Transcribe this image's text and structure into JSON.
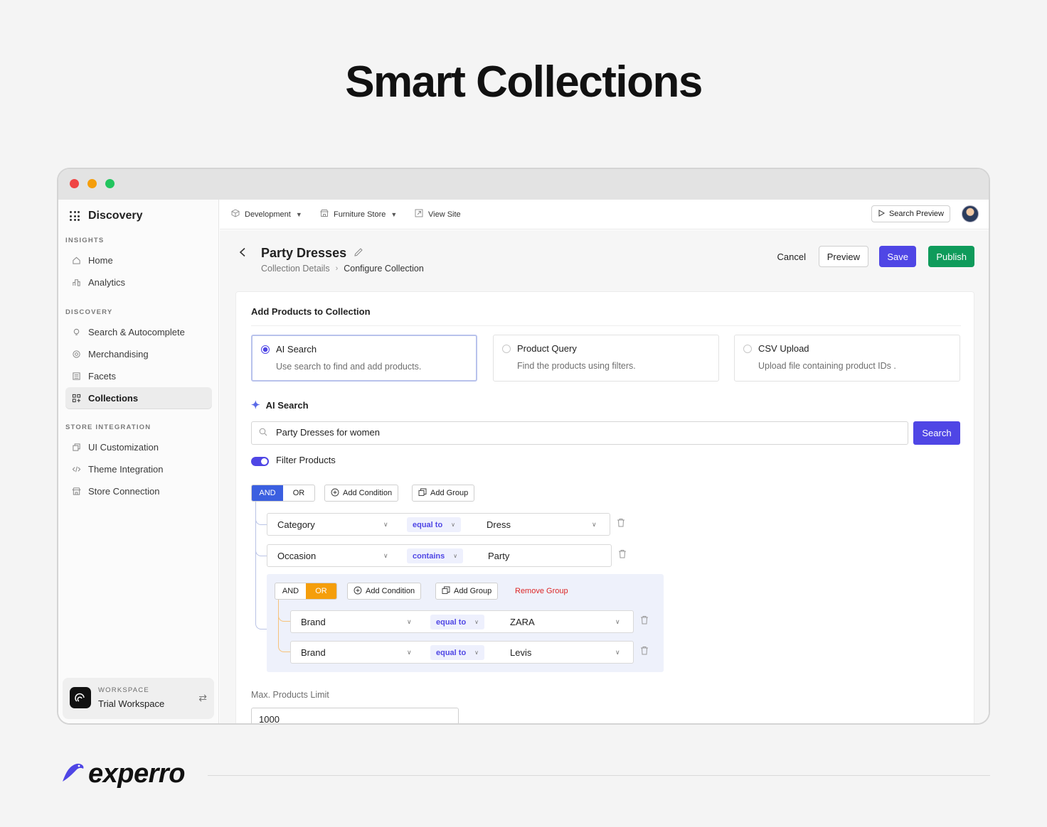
{
  "hero": {
    "title": "Smart Collections"
  },
  "sidebar": {
    "brand": "Discovery",
    "sections": {
      "insights": "INSIGHTS",
      "discovery": "DISCOVERY",
      "store": "STORE INTEGRATION"
    },
    "items": {
      "home": "Home",
      "analytics": "Analytics",
      "search": "Search & Autocomplete",
      "merch": "Merchandising",
      "facets": "Facets",
      "collections": "Collections",
      "ui": "UI Customization",
      "theme": "Theme Integration",
      "store": "Store Connection"
    },
    "workspace": {
      "label": "WORKSPACE",
      "name": "Trial Workspace"
    }
  },
  "topbar": {
    "env": "Development",
    "store": "Furniture Store",
    "view_site": "View Site",
    "search_preview": "Search Preview"
  },
  "header": {
    "title": "Party Dresses",
    "crumb_parent": "Collection Details",
    "crumb_current": "Configure Collection",
    "cancel": "Cancel",
    "preview": "Preview",
    "save": "Save",
    "publish": "Publish"
  },
  "card": {
    "title": "Add Products to Collection",
    "options": [
      {
        "title": "AI Search",
        "desc": "Use search to find and add products."
      },
      {
        "title": "Product Query",
        "desc": "Find the products using filters."
      },
      {
        "title": "CSV Upload",
        "desc": "Upload file containing product IDs ."
      }
    ],
    "ai_label": "AI Search",
    "search_value": "Party Dresses for women",
    "search_button": "Search",
    "filter_label": "Filter Products",
    "limit_label": "Max. Products Limit",
    "limit_value": "1000"
  },
  "filters": {
    "and": "AND",
    "or": "OR",
    "add_condition": "Add Condition",
    "add_group": "Add Group",
    "remove_group": "Remove Group",
    "conditions": [
      {
        "field": "Category",
        "op": "equal to",
        "value": "Dress"
      },
      {
        "field": "Occasion",
        "op": "contains",
        "value": "Party"
      }
    ],
    "group_conditions": [
      {
        "field": "Brand",
        "op": "equal to",
        "value": "ZARA"
      },
      {
        "field": "Brand",
        "op": "equal to",
        "value": "Levis"
      }
    ],
    "root_logic": "AND",
    "group_logic": "OR"
  },
  "footer": {
    "brand": "experro"
  },
  "colors": {
    "primary": "#4f46e5",
    "publish": "#0f9b5b",
    "or_active": "#f59e0b",
    "danger": "#dc2626"
  }
}
